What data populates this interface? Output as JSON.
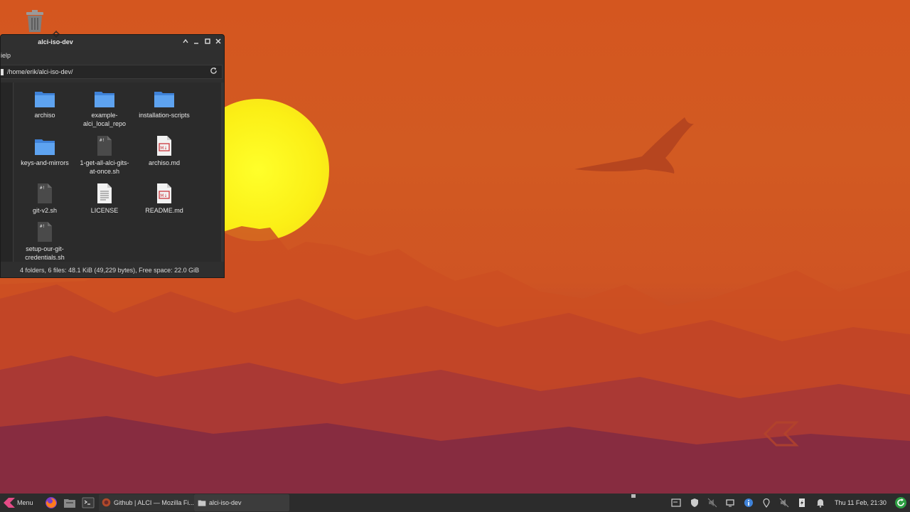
{
  "window": {
    "title": "alci-iso-dev",
    "menu_label": "ielp",
    "path": "/home/erik/alci-iso-dev/",
    "status": "4 folders, 6 files: 48.1 KiB (49,229 bytes), Free space: 22.0 GiB",
    "files": [
      {
        "name": "archiso",
        "kind": "folder"
      },
      {
        "name": "example-alci_local_repo",
        "line1": "example-",
        "line2": "alci_local_repo",
        "kind": "folder"
      },
      {
        "name": "installation-scripts",
        "kind": "folder"
      },
      {
        "name": "keys-and-mirrors",
        "kind": "folder"
      },
      {
        "name": "1-get-all-alci-gits-at-once.sh",
        "line1": "1-get-all-alci-gits-",
        "line2": "at-once.sh",
        "kind": "script"
      },
      {
        "name": "archiso.md",
        "kind": "markdown"
      },
      {
        "name": "git-v2.sh",
        "kind": "script"
      },
      {
        "name": "LICENSE",
        "kind": "text"
      },
      {
        "name": "README.md",
        "kind": "markdown"
      },
      {
        "name": "setup-our-git-credentials.sh",
        "line1": "setup-our-git-",
        "line2": "credentials.sh",
        "kind": "script"
      }
    ]
  },
  "taskbar": {
    "menu_label": "Menu",
    "tasks": [
      {
        "label": "Github | ALCI — Mozilla Fi..."
      },
      {
        "label": "alci-iso-dev"
      }
    ],
    "clock": "Thu 11 Feb, 21:30"
  },
  "colors": {
    "folder": "#4a90e2",
    "accent": "#f9f032",
    "panel": "#2c2c2c"
  }
}
